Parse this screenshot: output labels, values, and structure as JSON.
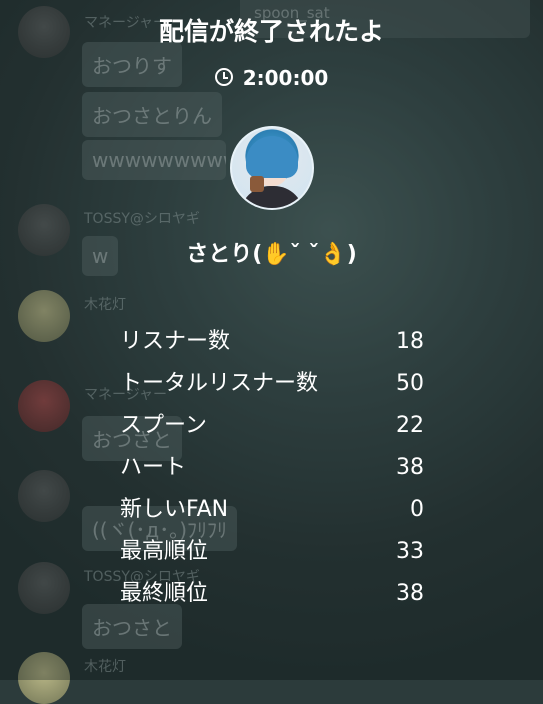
{
  "header": {
    "title": "配信が終了されたよ",
    "duration": "2:00:00"
  },
  "broadcaster": {
    "name": "さとり(✋ˇ ˇ👌)"
  },
  "stats": [
    {
      "label": "リスナー数",
      "value": "18"
    },
    {
      "label": "トータルリスナー数",
      "value": "50"
    },
    {
      "label": "スプーン",
      "value": "22"
    },
    {
      "label": "ハート",
      "value": "38"
    },
    {
      "label": "新しいFAN",
      "value": "0"
    },
    {
      "label": "最高順位",
      "value": "33"
    },
    {
      "label": "最終順位",
      "value": "38"
    }
  ],
  "background_chat": {
    "names": [
      "マネージャー",
      "TOSSY@シロヤギ",
      "木花灯",
      "マネージャー",
      "TOSSY@シロヤギ",
      "木花灯"
    ],
    "messages": [
      "おつりす",
      "おつさとりん",
      "wwwwwwwww",
      "w",
      "おつさと",
      "((ヾ(･д･｡)ﾌﾘﾌﾘ",
      "おつさと"
    ],
    "corner_text": "spoon_sat"
  }
}
